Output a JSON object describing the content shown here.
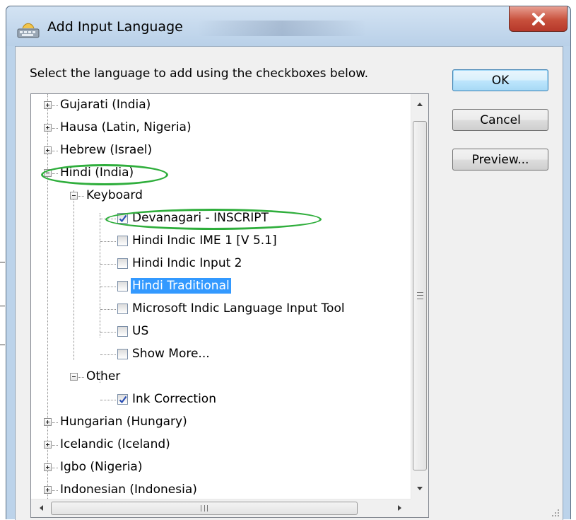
{
  "window": {
    "title": "Add Input Language",
    "close_glyph": "X"
  },
  "instruction": "Select the language to add using the checkboxes below.",
  "buttons": {
    "ok": "OK",
    "cancel": "Cancel",
    "preview": "Preview..."
  },
  "tree": {
    "rows": [
      {
        "label": "Gujarati (India)",
        "type": "language",
        "expanded": false
      },
      {
        "label": "Hausa (Latin, Nigeria)",
        "type": "language",
        "expanded": false
      },
      {
        "label": "Hebrew (Israel)",
        "type": "language",
        "expanded": false
      },
      {
        "label": "Hindi (India)",
        "type": "language",
        "expanded": true
      },
      {
        "label": "Keyboard",
        "type": "group",
        "expanded": true
      },
      {
        "label": "Devanagari - INSCRIPT",
        "type": "option",
        "checked": true
      },
      {
        "label": "Hindi Indic IME 1 [V 5.1]",
        "type": "option",
        "checked": false
      },
      {
        "label": "Hindi Indic Input 2",
        "type": "option",
        "checked": false
      },
      {
        "label": "Hindi Traditional",
        "type": "option",
        "checked": false,
        "selected": true
      },
      {
        "label": "Microsoft Indic Language Input Tool",
        "type": "option",
        "checked": false
      },
      {
        "label": "US",
        "type": "option",
        "checked": false
      },
      {
        "label": "Show More...",
        "type": "option",
        "checked": false
      },
      {
        "label": "Other",
        "type": "group",
        "expanded": true
      },
      {
        "label": "Ink Correction",
        "type": "option",
        "checked": true
      },
      {
        "label": "Hungarian (Hungary)",
        "type": "language",
        "expanded": false
      },
      {
        "label": "Icelandic (Iceland)",
        "type": "language",
        "expanded": false
      },
      {
        "label": "Igbo (Nigeria)",
        "type": "language",
        "expanded": false
      },
      {
        "label": "Indonesian (Indonesia)",
        "type": "language",
        "expanded": false
      }
    ]
  },
  "icons": {
    "app": "keyboard-icon",
    "close": "close-icon",
    "scroll_up": "arrow-up-icon",
    "scroll_down": "arrow-down-icon",
    "scroll_left": "arrow-left-icon",
    "scroll_right": "arrow-right-icon"
  },
  "colors": {
    "selection": "#3399ff",
    "annotation": "#2fae3c",
    "checkmark": "#2a4fb5",
    "close_button": "#c8503c"
  }
}
